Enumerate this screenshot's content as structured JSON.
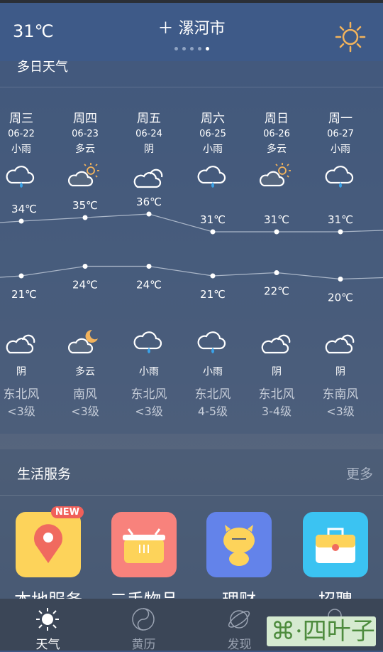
{
  "header": {
    "current_temp": "31℃",
    "city": "＋ 漯河市",
    "page_count": 5,
    "active_page": 5,
    "weather_icon": "sun-icon"
  },
  "forecast": {
    "title": "多日天气",
    "days": [
      {
        "weekday": "周三",
        "date": "06-22",
        "day_weather": "小雨",
        "day_icon": "rain-icon",
        "high": "34℃",
        "low": "21℃",
        "night_icon": "cloud-icon",
        "night_weather": "阴",
        "wind_dir": "东北风",
        "wind_level": "<3级"
      },
      {
        "weekday": "周四",
        "date": "06-23",
        "day_weather": "多云",
        "day_icon": "partly-cloudy-icon",
        "high": "35℃",
        "low": "24℃",
        "night_icon": "cloud-moon-icon",
        "night_weather": "多云",
        "wind_dir": "南风",
        "wind_level": "<3级"
      },
      {
        "weekday": "周五",
        "date": "06-24",
        "day_weather": "阴",
        "day_icon": "cloud-icon",
        "high": "36℃",
        "low": "24℃",
        "night_icon": "rain-icon",
        "night_weather": "小雨",
        "wind_dir": "东北风",
        "wind_level": "<3级"
      },
      {
        "weekday": "周六",
        "date": "06-25",
        "day_weather": "小雨",
        "day_icon": "rain-icon",
        "high": "31℃",
        "low": "21℃",
        "night_icon": "rain-icon",
        "night_weather": "小雨",
        "wind_dir": "东北风",
        "wind_level": "4-5级"
      },
      {
        "weekday": "周日",
        "date": "06-26",
        "day_weather": "多云",
        "day_icon": "partly-cloudy-icon",
        "high": "31℃",
        "low": "22℃",
        "night_icon": "cloud-icon",
        "night_weather": "阴",
        "wind_dir": "东北风",
        "wind_level": "3-4级"
      },
      {
        "weekday": "周一",
        "date": "06-27",
        "day_weather": "小雨",
        "day_icon": "rain-icon",
        "high": "31℃",
        "low": "20℃",
        "night_icon": "cloud-icon",
        "night_weather": "阴",
        "wind_dir": "东南风",
        "wind_level": "<3级"
      }
    ],
    "highs": [
      34,
      35,
      36,
      31,
      31,
      31
    ],
    "lows": [
      21,
      24,
      24,
      21,
      22,
      20
    ]
  },
  "services": {
    "title": "生活服务",
    "more": "更多",
    "badge": "NEW",
    "items": [
      {
        "label": "本地服务",
        "color": "#fdd35a",
        "icon": "map-pin-icon"
      },
      {
        "label": "二手物品",
        "color": "#f8827c",
        "icon": "basket-icon"
      },
      {
        "label": "理财",
        "color": "#6383ea",
        "icon": "mascot-icon"
      },
      {
        "label": "招聘",
        "color": "#3bc3f2",
        "icon": "briefcase-icon"
      }
    ]
  },
  "nav": {
    "items": [
      {
        "label": "天气",
        "icon": "sun-icon"
      },
      {
        "label": "黄历",
        "icon": "yin-yang-icon"
      },
      {
        "label": "发现",
        "icon": "planet-icon"
      },
      {
        "icon": "user-icon"
      }
    ]
  },
  "watermark": "⌘·四叶子"
}
